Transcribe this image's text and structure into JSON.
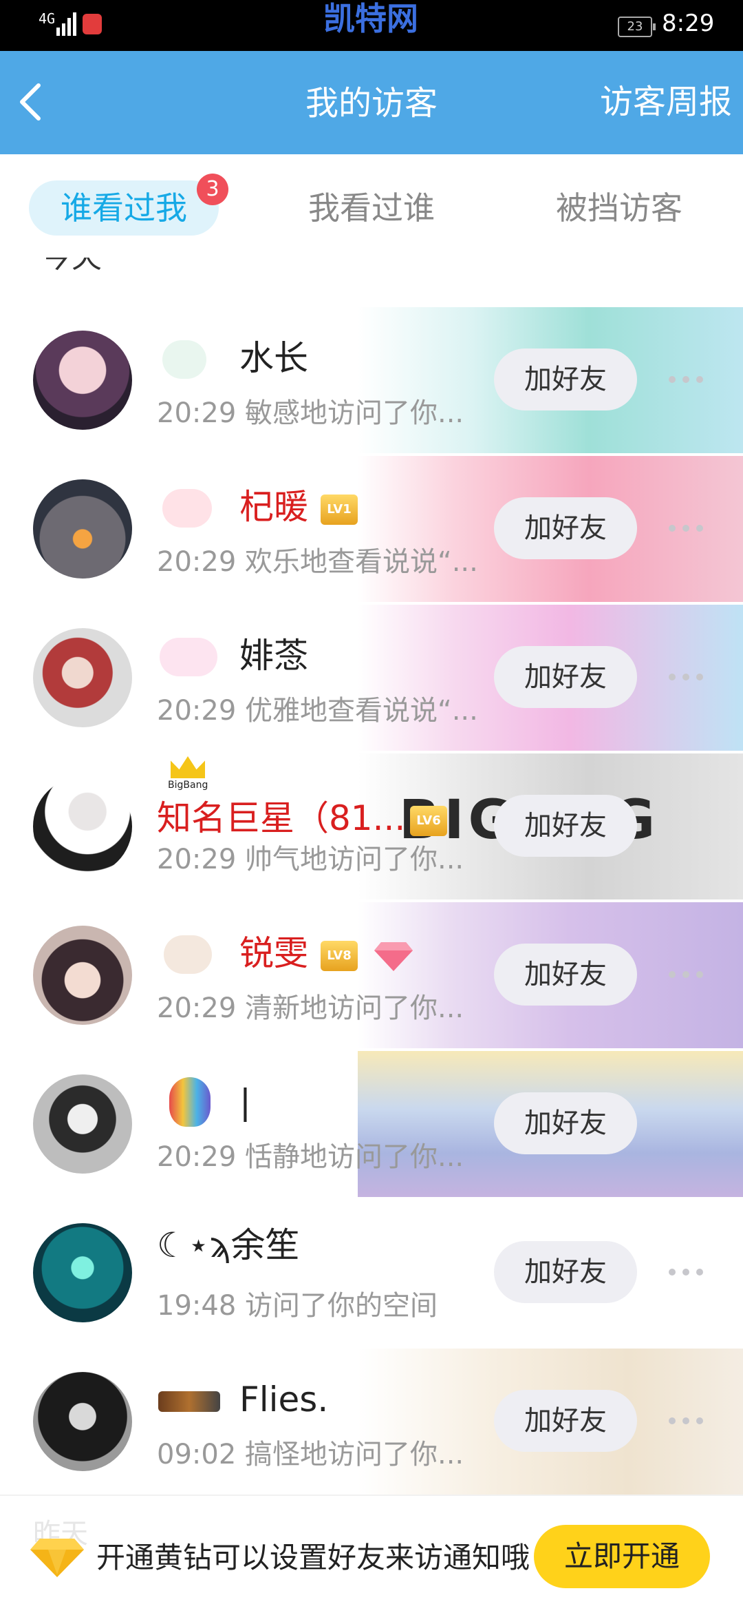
{
  "status_bar": {
    "signal": "4G",
    "watermark": "凯特网",
    "battery": "23",
    "time": "8:29"
  },
  "header": {
    "title": "我的访客",
    "weekly_report": "访客周报"
  },
  "tabs": [
    {
      "label": "谁看过我",
      "badge": "3",
      "active": true
    },
    {
      "label": "我看过谁",
      "active": false
    },
    {
      "label": "被挡访客",
      "active": false
    }
  ],
  "partial_header": "今天",
  "visitors": [
    {
      "name": "水长",
      "time": "20:29",
      "action": "敏感地访问了你...",
      "button": "加好友"
    },
    {
      "name": "杞暖",
      "time": "20:29",
      "action": "欢乐地查看说说“...",
      "button": "加好友",
      "level": "LV1"
    },
    {
      "name": "婔菍",
      "time": "20:29",
      "action": "优雅地查看说说“...",
      "button": "加好友"
    },
    {
      "name": "知名巨星（81...",
      "time": "20:29",
      "action": "帅气地访问了你...",
      "button": "加好友",
      "level": "LV6",
      "bg_text": "BIG  NG",
      "crown_label": "BigBang"
    },
    {
      "name": "锐雯",
      "time": "20:29",
      "action": "清新地访问了你...",
      "button": "加好友",
      "level": "LV8"
    },
    {
      "name": "|",
      "time": "20:29",
      "action": "恬静地访问了你...",
      "button": "加好友"
    },
    {
      "name": "☾⋆ϡ余笙",
      "time": "19:48",
      "action": "访问了你的空间",
      "button": "加好友"
    },
    {
      "name": "Flies.",
      "time": "09:02",
      "action": "搞怪地访问了你...",
      "button": "加好友"
    }
  ],
  "footer": {
    "ghost": "昨天",
    "text": "开通黄钻可以设置好友来访通知哦",
    "button": "立即开通"
  },
  "colors": {
    "header_blue": "#4fa8e6",
    "active_tab": "#16a9e6",
    "badge_red": "#f04f5a",
    "vip_red": "#d91f1f",
    "open_yellow": "#ffd21a"
  }
}
